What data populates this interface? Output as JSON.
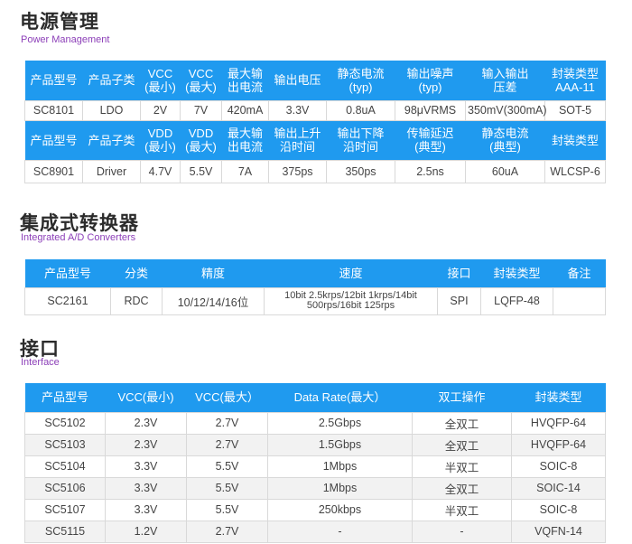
{
  "sections": {
    "power": {
      "title": "电源管理",
      "subtitle": "Power Management"
    },
    "adc": {
      "title": "集成式转换器",
      "subtitle": "Integrated A/D Converters"
    },
    "interface": {
      "title": "接口",
      "subtitle": "Interface"
    }
  },
  "power_table": {
    "header1": [
      "产品型号",
      "产品子类",
      "VCC\n(最小)",
      "VCC\n(最大)",
      "最大输\n出电流",
      "输出电压",
      "静态电流\n(typ)",
      "输出噪声\n(typ)",
      "输入输出\n压差",
      "封装类型\nAAA-11"
    ],
    "row1": [
      "SC8101",
      "LDO",
      "2V",
      "7V",
      "420mA",
      "3.3V",
      "0.8uA",
      "98μVRMS",
      "350mV(300mA)",
      "SOT-5"
    ],
    "header2": [
      "产品型号",
      "产品子类",
      "VDD\n(最小)",
      "VDD\n(最大)",
      "最大输\n出电流",
      "输出上升\n沿时间",
      "输出下降\n沿时间",
      "传输延迟\n(典型)",
      "静态电流\n(典型)",
      "封装类型"
    ],
    "row2": [
      "SC8901",
      "Driver",
      "4.7V",
      "5.5V",
      "7A",
      "375ps",
      "350ps",
      "2.5ns",
      "60uA",
      "WLCSP-6"
    ]
  },
  "adc_table": {
    "header": [
      "产品型号",
      "分类",
      "精度",
      "速度",
      "接口",
      "封装类型",
      "备注"
    ],
    "row": [
      "SC2161",
      "RDC",
      "10/12/14/16位",
      "10bit 2.5krps/12bit 1krps/14bit\n500rps/16bit 125rps",
      "SPI",
      "LQFP-48",
      ""
    ]
  },
  "interface_table": {
    "header": [
      "产品型号",
      "VCC(最小)",
      "VCC(最大）",
      "Data Rate(最大）",
      "双工操作",
      "封装类型"
    ],
    "rows": [
      [
        "SC5102",
        "2.3V",
        "2.7V",
        "2.5Gbps",
        "全双工",
        "HVQFP-64"
      ],
      [
        "SC5103",
        "2.3V",
        "2.7V",
        "1.5Gbps",
        "全双工",
        "HVQFP-64"
      ],
      [
        "SC5104",
        "3.3V",
        "5.5V",
        "1Mbps",
        "半双工",
        "SOIC-8"
      ],
      [
        "SC5106",
        "3.3V",
        "5.5V",
        "1Mbps",
        "全双工",
        "SOIC-14"
      ],
      [
        "SC5107",
        "3.3V",
        "5.5V",
        "250kbps",
        "半双工",
        "SOIC-8"
      ],
      [
        "SC5115",
        "1.2V",
        "2.7V",
        "-",
        "-",
        "VQFN-14"
      ]
    ]
  },
  "colors": {
    "header_bg": "#1f9aef",
    "subtitle": "#8c3fb8"
  }
}
